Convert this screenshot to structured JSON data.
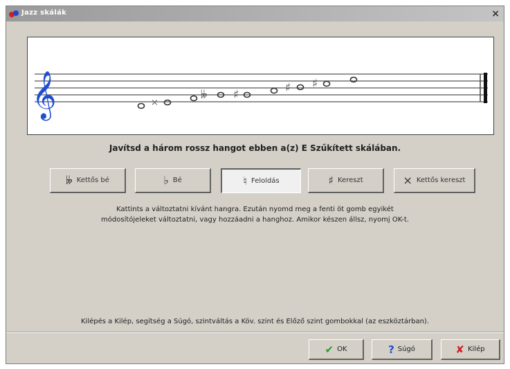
{
  "window": {
    "title": "Jazz skálák",
    "close_glyph": "×"
  },
  "instruction": "Javítsd a három rossz hangot ebben a(z) E Szűkített skálában.",
  "modifier_buttons": [
    {
      "label": "Kettős bé",
      "symbol": "𝄫",
      "icon": "double-flat-icon"
    },
    {
      "label": "Bé",
      "symbol": "♭",
      "icon": "flat-icon"
    },
    {
      "label": "Feloldás",
      "symbol": "♮",
      "icon": "natural-icon",
      "selected": true
    },
    {
      "label": "Kereszt",
      "symbol": "♯",
      "icon": "sharp-icon"
    },
    {
      "label": "Kettős kereszt",
      "symbol": "×",
      "icon": "double-sharp-icon"
    }
  ],
  "help_text": [
    "Kattints a változtatni kívánt hangra. Ezután nyomd meg a fenti öt gomb egyikét",
    "módosítójeleket változtatni, vagy hozzáadni a hanghoz. Amikor készen állsz, nyomj OK-t."
  ],
  "footer_text": "Kilépés a Kilép, segítség a Súgó, szintváltás a Köv. szint és Előző szint gombokkal (az eszköztárban).",
  "dialog_buttons": {
    "ok": {
      "label": "OK",
      "icon": "check-icon",
      "color": "#2a9a2a"
    },
    "help": {
      "label": "Súgó",
      "icon": "question-icon",
      "color": "#1f4fd0"
    },
    "exit": {
      "label": "Kilép",
      "icon": "x-icon",
      "color": "#d02020"
    }
  },
  "staff": {
    "clef": "treble-clef-icon",
    "accent": "#1f4fd0"
  }
}
